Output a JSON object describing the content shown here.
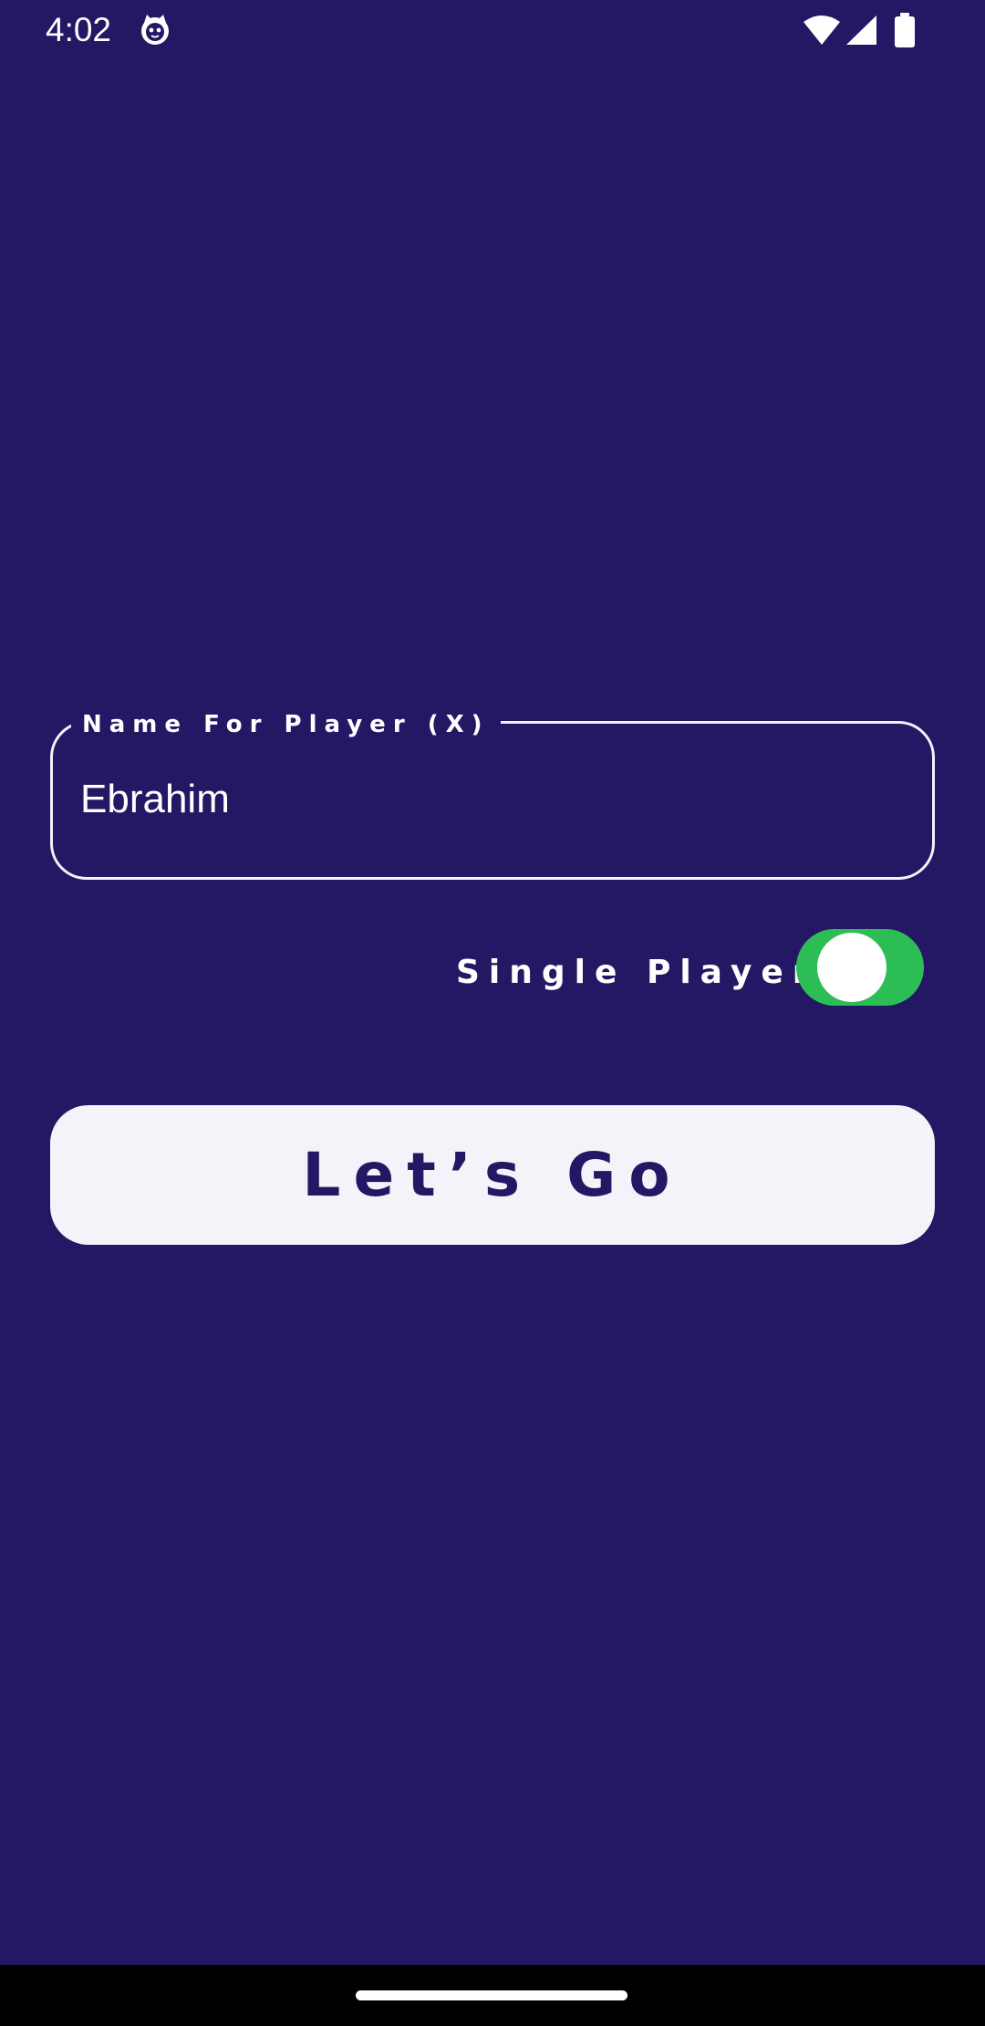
{
  "status_bar": {
    "time": "4:02",
    "app_icon": "cat-face-icon",
    "wifi_icon": "wifi-icon",
    "signal_icon": "cellular-signal-icon",
    "battery_icon": "battery-icon"
  },
  "name_field": {
    "label": "Name For Player (X)",
    "value": "Ebrahim"
  },
  "single_player": {
    "label": "Single Player",
    "enabled": true,
    "on_color": "#2dbd55"
  },
  "go_button": {
    "label": "Let’s Go"
  },
  "colors": {
    "background": "#241864",
    "button_background": "#f5f3f9",
    "text": "#ffffff"
  }
}
